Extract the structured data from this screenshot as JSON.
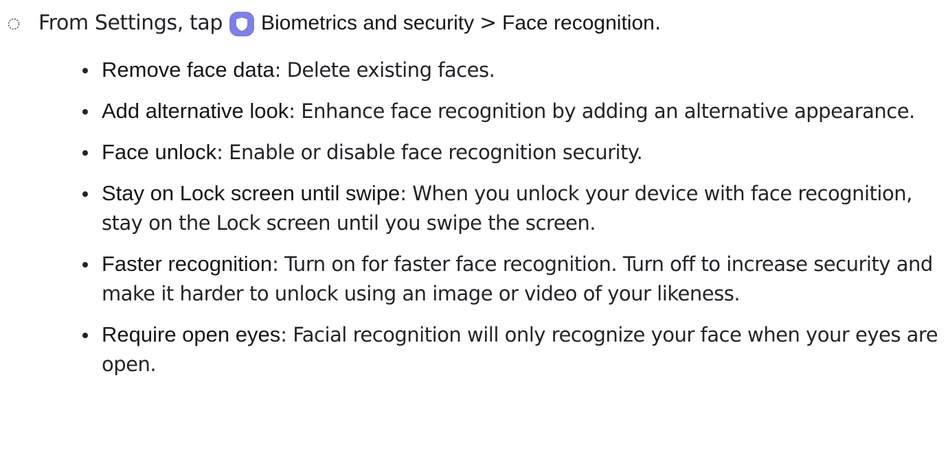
{
  "step": {
    "intro": "From Settings, tap",
    "menu_item": "Biometrics and security",
    "separator": ">",
    "sub_item": "Face recognition",
    "end_punctuation": ".",
    "icon": "shield-icon",
    "icon_color": "#7c7fe8"
  },
  "options": [
    {
      "term": "Remove face data",
      "separator": ": ",
      "description": "Delete existing faces."
    },
    {
      "term": "Add alternative look",
      "separator": ": ",
      "description": "Enhance face recognition by adding an alternative appearance."
    },
    {
      "term": "Face unlock",
      "separator": ": ",
      "description": "Enable or disable face recognition security."
    },
    {
      "term": "Stay on Lock screen until swipe",
      "separator": ": ",
      "description": "When you unlock your device with face recognition, stay on the Lock screen until you swipe the screen."
    },
    {
      "term": "Faster recognition",
      "separator": ": ",
      "description": "Turn on for faster face recognition. Turn off to increase security and make it harder to unlock using an image or video of your likeness."
    },
    {
      "term": "Require open eyes",
      "separator": ": ",
      "description": "Facial recognition will only recognize your face when your eyes are open."
    }
  ]
}
